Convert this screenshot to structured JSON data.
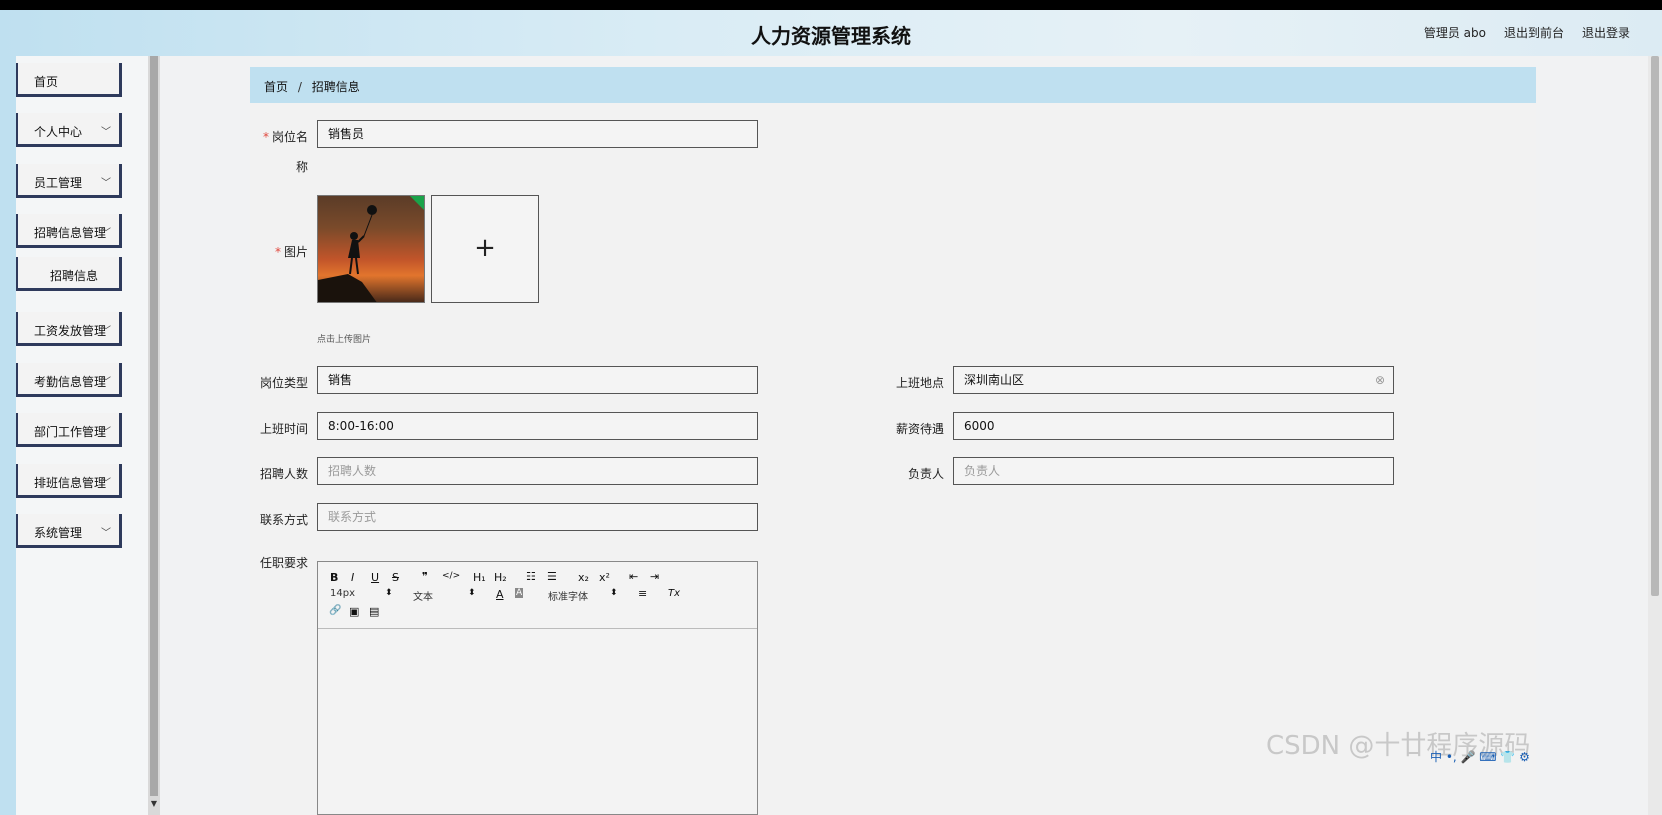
{
  "app": {
    "title": "人力资源管理系统"
  },
  "header_links": {
    "admin": "管理员 abo",
    "front": "退出到前台",
    "logout": "退出登录"
  },
  "menu": {
    "home": "首页",
    "personal": "个人中心",
    "staff": "员工管理",
    "recruit": "招聘信息管理",
    "recruit_sub": "招聘信息",
    "salary": "工资发放管理",
    "attendance": "考勤信息管理",
    "work": "部门工作管理",
    "schedule": "排班信息管理",
    "system": "系统管理"
  },
  "breadcrumb": {
    "home": "首页",
    "separator": "/",
    "current": "招聘信息"
  },
  "form": {
    "job_name_label_line1": "岗位名",
    "job_name_label_line2": "称",
    "job_name_value": "销售员",
    "image_label": "图片",
    "upload_hint": "点击上传图片",
    "plus": "+",
    "job_type_label": "岗位类型",
    "job_type_value": "销售",
    "location_label": "上班地点",
    "location_value": "深圳南山区",
    "work_time_label": "上班时间",
    "work_time_value": "8:00-16:00",
    "salary_label": "薪资待遇",
    "salary_value": "6000",
    "headcount_label": "招聘人数",
    "headcount_placeholder": "招聘人数",
    "owner_label": "负责人",
    "owner_placeholder": "负责人",
    "contact_label": "联系方式",
    "contact_placeholder": "联系方式",
    "requirements_label": "任职要求"
  },
  "editor": {
    "bold": "B",
    "italic": "I",
    "underline": "U",
    "strike": "S",
    "quote": "❞",
    "code": "</>",
    "h1": "H₁",
    "h2": "H₂",
    "ol": "☷",
    "ul": "☰",
    "sub": "x₂",
    "sup": "x²",
    "outdent": "⇤",
    "indent": "⇥",
    "size": "14px",
    "format": "文本",
    "font": "标准字体",
    "color": "A",
    "bg": "A",
    "align": "≡",
    "clean": "Tx",
    "link": "🔗",
    "image": "▣",
    "video": "▤"
  },
  "watermark": "CSDN @十廿程序源码",
  "ime": "中 •, 🎤 ⌨ 👕 ⚙"
}
